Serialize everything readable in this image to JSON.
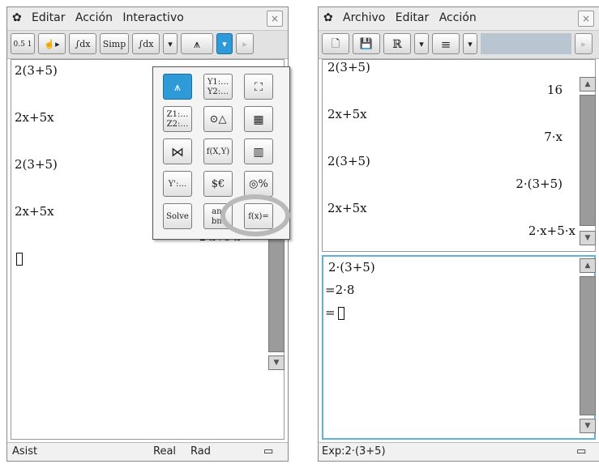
{
  "left": {
    "menu": {
      "items": [
        "Editar",
        "Acción",
        "Interactivo"
      ],
      "close": "×"
    },
    "toolbar": {
      "btn1": "0.5 1 ⇄ 1/2",
      "btn2": "☝▸",
      "btn3": "∫dx",
      "simp": "Simp",
      "btn5": "∫dx",
      "arrow": "▾",
      "graph": "⩚",
      "dropdown": "▾",
      "next": "▸"
    },
    "work": {
      "lines": [
        "2(3+5)",
        "2x+5x",
        "2(3+5)",
        "2x+5x"
      ],
      "partial": "2·x+5·x"
    },
    "palette": {
      "keys": [
        "⩚",
        "Y1:… Y2:…",
        "⛶",
        "Z1:… Z2:…",
        "⊙△",
        "▦",
        "⋈",
        "f(X,Y)",
        "▥",
        "Y':…",
        "$€",
        "◎%",
        "Solve",
        "an: bn:",
        "f(x)="
      ]
    },
    "status": {
      "mode": "Asist",
      "real": "Real",
      "angle": "Rad",
      "battery": "▭"
    }
  },
  "right": {
    "menu": {
      "items": [
        "Archivo",
        "Editar",
        "Acción"
      ],
      "close": "×"
    },
    "toolbar": {
      "new": "🗋",
      "save": "💾",
      "real": "ℝ",
      "arrow1": "▾",
      "list": "≡",
      "arrow2": "▾",
      "next": "▸"
    },
    "top": {
      "entries": [
        {
          "expr": "2(3+5)",
          "result": "16"
        },
        {
          "expr": "2x+5x",
          "result": "7·x"
        },
        {
          "expr": "2(3+5)",
          "result": "2·(3+5)"
        },
        {
          "expr": "2x+5x",
          "result": "2·x+5·x"
        }
      ]
    },
    "bottom": {
      "lines": [
        "2·(3+5)",
        "=2·8",
        "="
      ]
    },
    "status": {
      "expression": "Exp:2·(3+5)",
      "battery": "▭"
    }
  }
}
